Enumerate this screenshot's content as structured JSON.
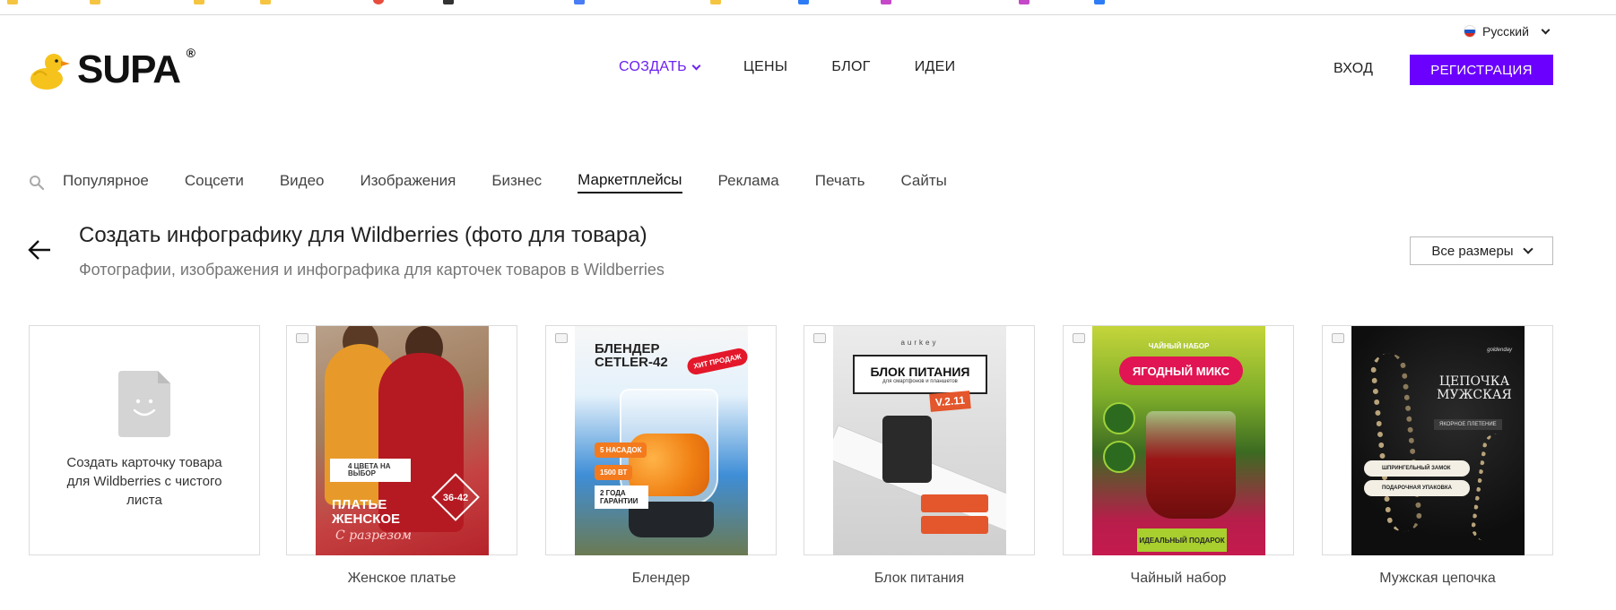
{
  "header": {
    "logo_text": "SUPA",
    "logo_reg": "®",
    "nav": [
      {
        "label": "СОЗДАТЬ",
        "active": true
      },
      {
        "label": "ЦЕНЫ"
      },
      {
        "label": "БЛОГ"
      },
      {
        "label": "ИДЕИ"
      }
    ],
    "language": "Русский",
    "login": "ВХОД",
    "register": "РЕГИСТРАЦИЯ",
    "accent_color": "#6b00ff"
  },
  "categories": [
    {
      "label": "Популярное"
    },
    {
      "label": "Соцсети"
    },
    {
      "label": "Видео"
    },
    {
      "label": "Изображения"
    },
    {
      "label": "Бизнес"
    },
    {
      "label": "Маркетплейсы",
      "active": true
    },
    {
      "label": "Реклама"
    },
    {
      "label": "Печать"
    },
    {
      "label": "Сайты"
    }
  ],
  "page": {
    "title": "Создать инфографику для Wildberries (фото для товара)",
    "subtitle": "Фотографии, изображения и инфографика для карточек товаров в Wildberries",
    "sizes_dropdown": "Все размеры"
  },
  "blank_card": {
    "text": "Создать карточку товара для Wildberries с чистого листа"
  },
  "templates": [
    {
      "caption": "Женское платье",
      "art": {
        "tag": "4 ЦВЕТА НА ВЫБОР",
        "size": "36-42",
        "title": "ПЛАТЬЕ ЖЕНСКОЕ",
        "script": "С разрезом"
      }
    },
    {
      "caption": "Блендер",
      "art": {
        "title": "БЛЕНДЕР CETLER-42",
        "hit": "ХИТ ПРОДАЖ",
        "p1": "5 НАСАДОК",
        "p2": "1500 ВТ",
        "guarantee": "2 ГОДА ГАРАНТИИ"
      }
    },
    {
      "caption": "Блок питания",
      "art": {
        "brand": "aurkey",
        "title": "БЛОК ПИТАНИЯ",
        "subtitle": "для смартфонов и планшетов",
        "version": "V.2.11"
      }
    },
    {
      "caption": "Чайный набор",
      "art": {
        "top": "ЧАЙНЫЙ НАБОР",
        "pill": "ЯГОДНЫЙ МИКС",
        "gift": "ИДЕАЛЬНЫЙ ПОДАРОК"
      }
    },
    {
      "caption": "Мужская цепочка",
      "art": {
        "brand": "goldenday",
        "title": "ЦЕПОЧКА МУЖСКАЯ",
        "sub": "ЯКОРНОЕ ПЛЕТЕНИЕ",
        "r1": "ШПРИНГЕЛЬНЫЙ ЗАМОК",
        "r2": "ПОДАРОЧНАЯ УПАКОВКА"
      }
    }
  ]
}
